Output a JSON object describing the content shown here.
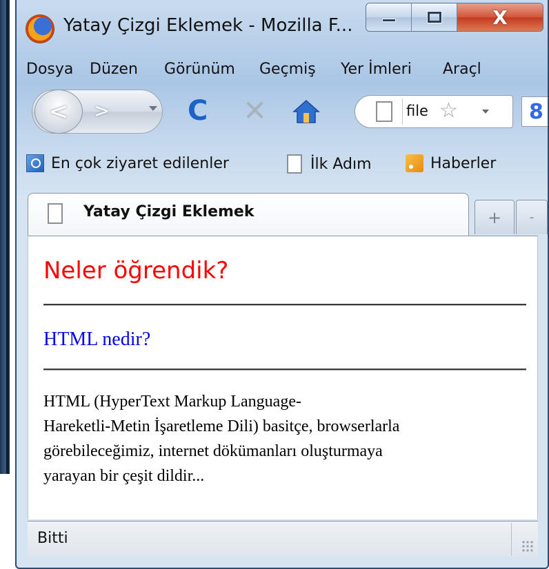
{
  "window": {
    "title": "Yatay Çizgi Eklemek - Mozilla F...",
    "close_glyph": "X"
  },
  "menu": {
    "items": [
      "Dosya",
      "Düzen",
      "Görünüm",
      "Geçmiş",
      "Yer İmleri",
      "Araçl"
    ]
  },
  "navigation": {
    "back_glyph": "<",
    "forward_glyph": ">",
    "reload_glyph": "C",
    "stop_glyph": "✕",
    "url_text": "file",
    "star_glyph": "☆",
    "search_engine_glyph": "8"
  },
  "bookmarks": {
    "items": [
      "En çok ziyaret edilenler",
      "İlk Adım",
      "Haberler"
    ]
  },
  "tabs": {
    "active_title": "Yatay Çizgi Eklemek",
    "new_tab_glyph": "+",
    "all_tabs_glyph": "-"
  },
  "page": {
    "heading": "Neler öğrendik?",
    "subheading": "HTML nedir?",
    "paragraph_lines": [
      "HTML (HyperText Markup Language-",
      "Hareketli-Metin İşaretleme Dili) basitçe, browserlarla",
      "görebileceğimiz, internet dökümanları oluşturmaya",
      "yarayan bir çeşit dildir..."
    ]
  },
  "status": {
    "text": "Bitti"
  },
  "colors": {
    "heading": "#ff0000",
    "subheading": "#0000ee",
    "reload": "#1c63c7",
    "close_button": "#c4391f"
  }
}
